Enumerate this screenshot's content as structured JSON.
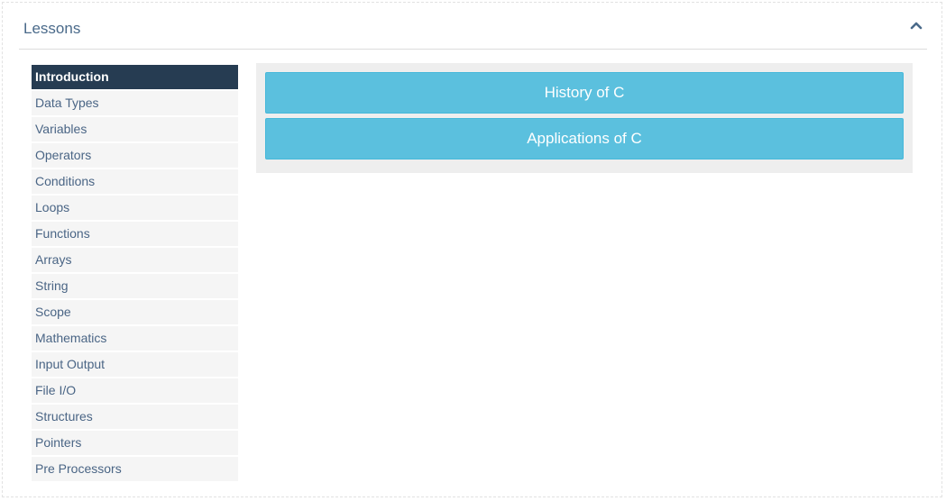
{
  "panel": {
    "title": "Lessons",
    "collapse_icon": "chevron-up-icon"
  },
  "sidebar": {
    "items": [
      {
        "label": "Introduction",
        "active": true
      },
      {
        "label": "Data Types"
      },
      {
        "label": "Variables"
      },
      {
        "label": "Operators"
      },
      {
        "label": "Conditions"
      },
      {
        "label": "Loops"
      },
      {
        "label": "Functions"
      },
      {
        "label": "Arrays"
      },
      {
        "label": "String"
      },
      {
        "label": "Scope"
      },
      {
        "label": "Mathematics"
      },
      {
        "label": "Input Output"
      },
      {
        "label": "File I/O"
      },
      {
        "label": "Structures"
      },
      {
        "label": "Pointers"
      },
      {
        "label": "Pre Processors"
      }
    ]
  },
  "content": {
    "topics": [
      {
        "label": "History of C"
      },
      {
        "label": "Applications of C"
      }
    ]
  },
  "colors": {
    "active_item_bg": "#263c52",
    "item_bg": "#f5f5f5",
    "item_text": "#4a6585",
    "topic_button_bg": "#5bc0de",
    "content_bg": "#eeeeee"
  }
}
